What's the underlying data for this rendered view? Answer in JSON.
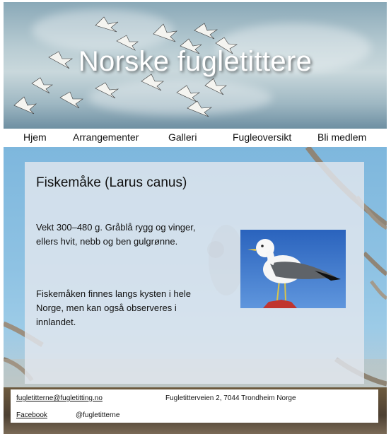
{
  "header": {
    "site_title": "Norske fugletittere"
  },
  "nav": {
    "items": [
      {
        "label": "Hjem"
      },
      {
        "label": "Arrangementer"
      },
      {
        "label": "Galleri"
      },
      {
        "label": "Fugleoversikt"
      },
      {
        "label": "Bli medlem"
      }
    ]
  },
  "article": {
    "title": "Fiskemåke (Larus canus)",
    "paragraph1": "Vekt 300–480 g. Gråblå rygg og vinger, ellers hvit, nebb og ben gulgrønne.",
    "paragraph2": "Fiskemåken finnes langs kysten i hele Norge, men kan også observeres i innlandet.",
    "photo_icon": "common-gull-photo"
  },
  "footer": {
    "email": "fugletitterne@fugletitting.no",
    "address": "Fugletitterveien 2, 7044 Trondheim Norge",
    "facebook_label": "Facebook",
    "facebook_handle": "@fugletitterne"
  },
  "colors": {
    "sky_blue": "#8ec2e3",
    "card_overlay": "#e2e7ee",
    "title_white": "#ffffff"
  }
}
